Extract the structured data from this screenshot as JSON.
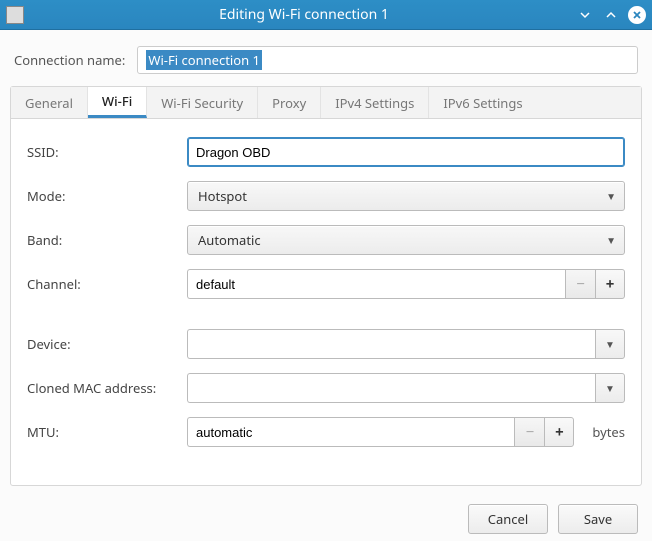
{
  "window": {
    "title": "Editing Wi-Fi connection 1"
  },
  "connection_name": {
    "label": "Connection name:",
    "value": "Wi-Fi connection 1"
  },
  "tabs": {
    "general": "General",
    "wifi": "Wi-Fi",
    "wifi_security": "Wi-Fi Security",
    "proxy": "Proxy",
    "ipv4": "IPv4 Settings",
    "ipv6": "IPv6 Settings",
    "active": "wifi"
  },
  "fields": {
    "ssid": {
      "label": "SSID:",
      "value": "Dragon OBD"
    },
    "mode": {
      "label": "Mode:",
      "value": "Hotspot"
    },
    "band": {
      "label": "Band:",
      "value": "Automatic"
    },
    "channel": {
      "label": "Channel:",
      "value": "default"
    },
    "device": {
      "label": "Device:",
      "value": ""
    },
    "cloned": {
      "label": "Cloned MAC address:",
      "value": ""
    },
    "mtu": {
      "label": "MTU:",
      "value": "automatic",
      "suffix": "bytes"
    }
  },
  "footer": {
    "cancel": "Cancel",
    "save": "Save"
  }
}
